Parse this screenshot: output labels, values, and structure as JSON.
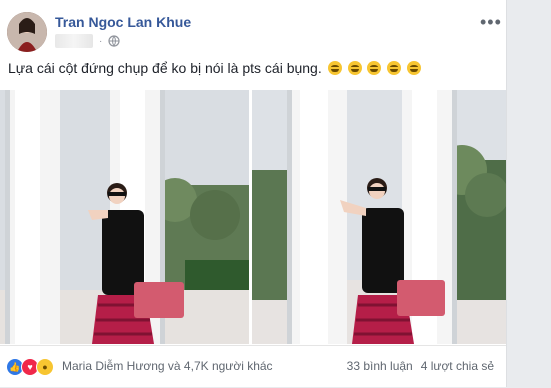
{
  "post": {
    "author": "Tran Ngoc Lan Khue",
    "caption": "Lựa cái cột đứng chụp để ko bị nói là pts cái bụng.",
    "emoji_count": 5,
    "emoji_icon": "grinning-face-icon",
    "more_icon": "more-horizontal-icon",
    "dots": "•••",
    "privacy_icon": "globe-icon",
    "meta_separator": "·",
    "photos": [
      {
        "name": "photo-left",
        "description_icon": "photo"
      },
      {
        "name": "photo-right",
        "description_icon": "photo"
      }
    ]
  },
  "footer": {
    "reactions": [
      "like-icon",
      "love-icon",
      "haha-icon"
    ],
    "reaction_text": "Maria Diễm Hương và 4,7K người khác",
    "comments": "33 bình luận",
    "shares": "4 lượt chia sẻ"
  },
  "colors": {
    "author": "#365899",
    "like": "#2f78e6",
    "love": "#f0284a",
    "haha": "#f7c531"
  }
}
